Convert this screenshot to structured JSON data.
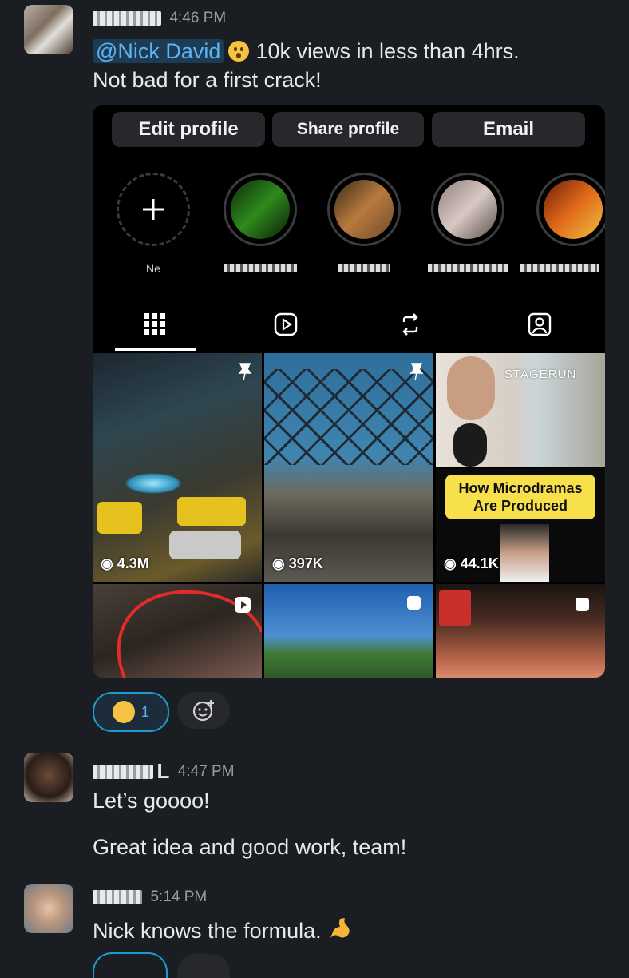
{
  "messages": [
    {
      "time": "4:46 PM",
      "mention": "@Nick David",
      "text_after_mention": "10k views in less than 4hrs.",
      "line2": "Not bad for a first crack!",
      "reaction_count": "1"
    },
    {
      "time": "4:47 PM",
      "initial": "L",
      "line1": "Let’s goooo!",
      "line2": "Great idea and good work, team!"
    },
    {
      "time": "5:14 PM",
      "text": "Nick knows the formula."
    }
  ],
  "embed": {
    "buttons": [
      "Edit profile",
      "Share profile",
      "Email"
    ],
    "new_story_label": "Ne",
    "pinned_text": "STAGERUN",
    "caption": "How Microdramas Are Produced",
    "views": [
      "4.3M",
      "397K",
      "44.1K"
    ]
  },
  "colors": {
    "background": "#1a1d21",
    "mention_bg": "#1d3b52",
    "mention_text": "#5fb3f3",
    "reaction_border": "#1d9bd1"
  }
}
